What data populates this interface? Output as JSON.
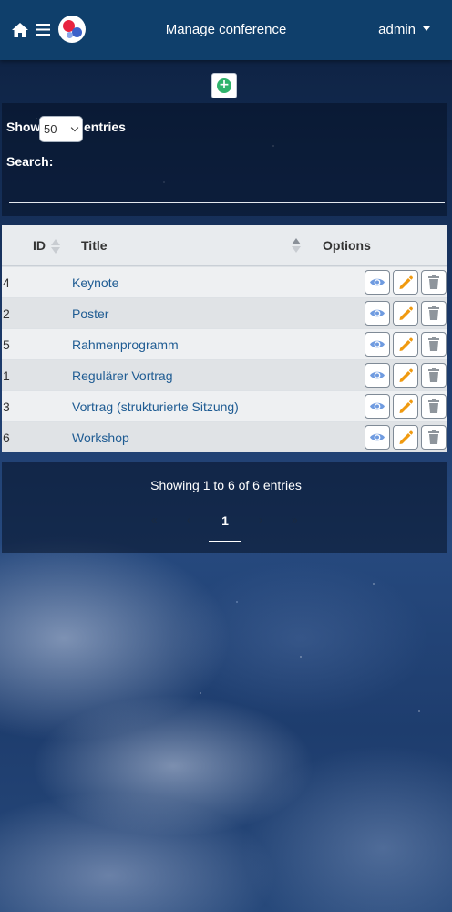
{
  "header": {
    "title": "Manage conference",
    "user": "admin",
    "home_icon": "home-icon",
    "menu_icon": "hamburger-menu-icon",
    "logo": "conference-logo"
  },
  "toolbar": {
    "add_icon": "plus-circle-icon",
    "add_color": "#2fb36c"
  },
  "controls": {
    "show_label": "Show",
    "length_value": "50",
    "entries_label": "entries",
    "search_label": "Search:",
    "search_value": ""
  },
  "table": {
    "columns": {
      "id": "ID",
      "title": "Title",
      "options": "Options"
    },
    "rows": [
      {
        "id": "4",
        "title": "Keynote"
      },
      {
        "id": "2",
        "title": "Poster"
      },
      {
        "id": "5",
        "title": "Rahmenprogramm"
      },
      {
        "id": "1",
        "title": "Regulärer Vortrag"
      },
      {
        "id": "3",
        "title": "Vortrag (strukturierte Sitzung)"
      },
      {
        "id": "6",
        "title": "Workshop"
      }
    ],
    "option_icons": [
      "eye-icon",
      "pencil-icon",
      "trash-icon"
    ],
    "colors": {
      "view": "#6f9be0",
      "edit": "#f09a10",
      "delete": "#8e959c",
      "link": "#1f5c93"
    }
  },
  "footer": {
    "info": "Showing 1 to 6 of 6 entries",
    "first": "«",
    "prev": "‹",
    "current_page": "1",
    "next": "›",
    "last": "»"
  }
}
